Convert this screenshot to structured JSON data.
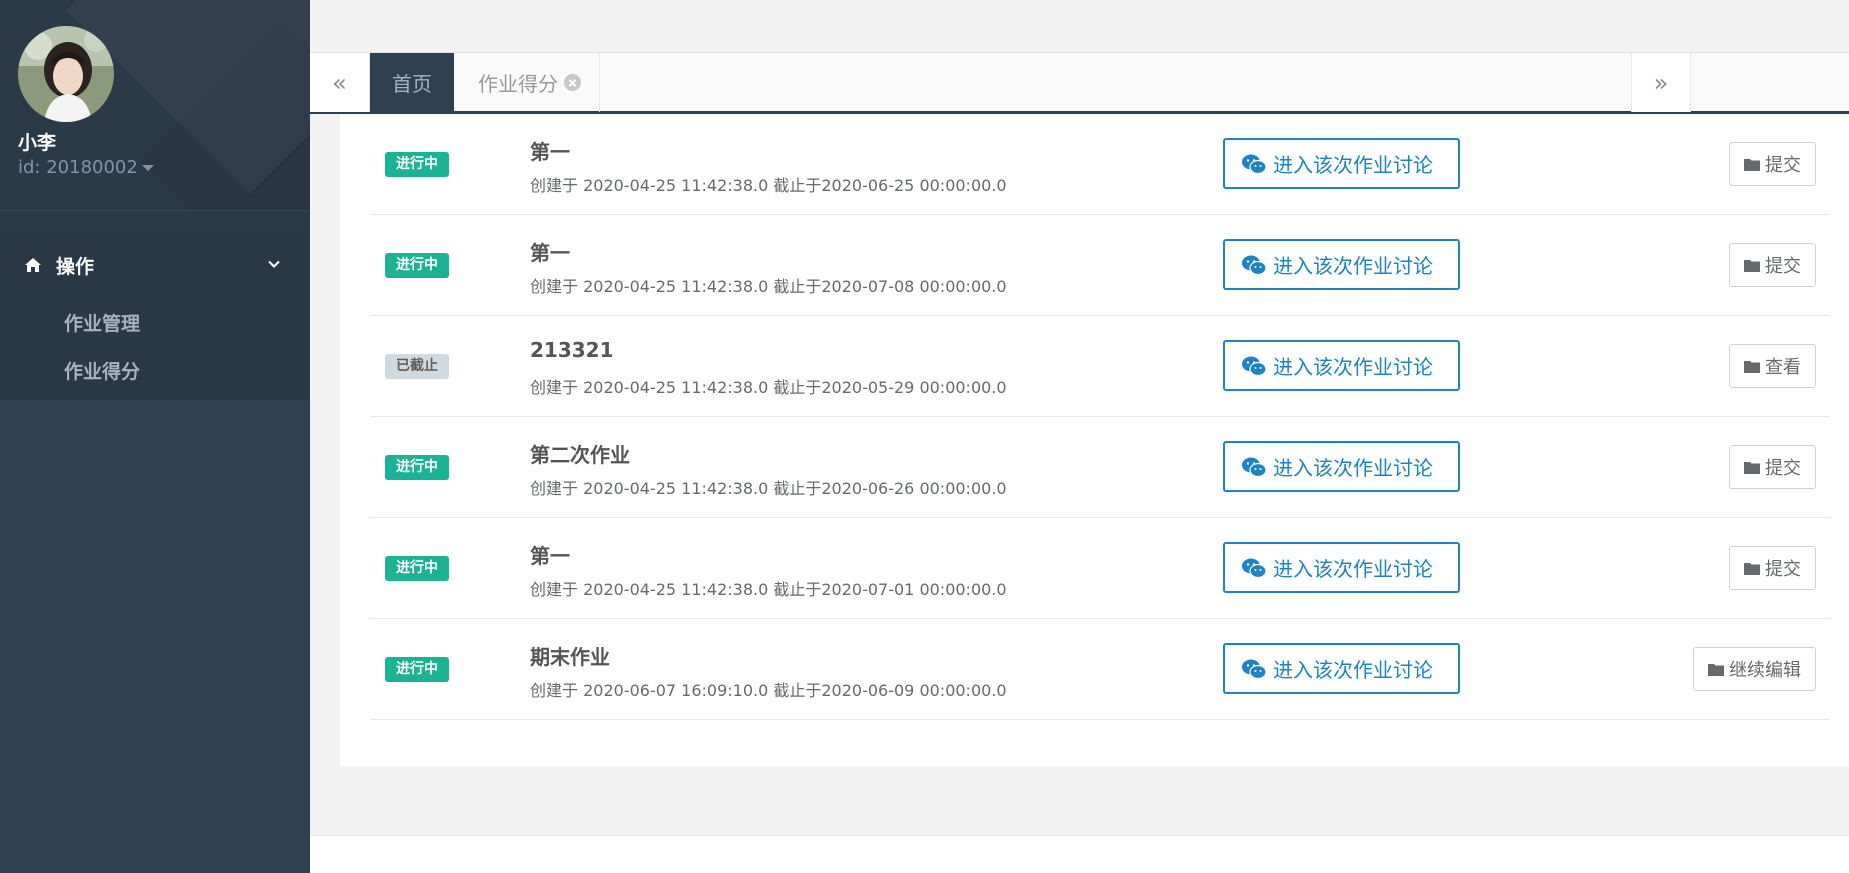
{
  "user": {
    "name": "小李",
    "id_label": "id: 20180002"
  },
  "nav": {
    "section_label": "操作",
    "items": [
      {
        "label": "作业管理"
      },
      {
        "label": "作业得分"
      }
    ]
  },
  "tabs": {
    "prev": "«",
    "next": "»",
    "items": [
      {
        "label": "首页",
        "active": true
      },
      {
        "label": "作业得分",
        "closable": true
      }
    ]
  },
  "assignments": [
    {
      "status": "进行中",
      "status_type": "active",
      "title": "第一",
      "meta": "创建于 2020-04-25 11:42:38.0 截止于2020-06-25 00:00:00.0",
      "discuss_label": "进入该次作业讨论",
      "action_label": "提交"
    },
    {
      "status": "进行中",
      "status_type": "active",
      "title": "第一",
      "meta": "创建于 2020-04-25 11:42:38.0 截止于2020-07-08 00:00:00.0",
      "discuss_label": "进入该次作业讨论",
      "action_label": "提交"
    },
    {
      "status": "已截止",
      "status_type": "closed",
      "title": "213321",
      "meta": "创建于 2020-04-25 11:42:38.0 截止于2020-05-29 00:00:00.0",
      "discuss_label": "进入该次作业讨论",
      "action_label": "查看"
    },
    {
      "status": "进行中",
      "status_type": "active",
      "title": "第二次作业",
      "meta": "创建于 2020-04-25 11:42:38.0 截止于2020-06-26 00:00:00.0",
      "discuss_label": "进入该次作业讨论",
      "action_label": "提交"
    },
    {
      "status": "进行中",
      "status_type": "active",
      "title": "第一",
      "meta": "创建于 2020-04-25 11:42:38.0 截止于2020-07-01 00:00:00.0",
      "discuss_label": "进入该次作业讨论",
      "action_label": "提交"
    },
    {
      "status": "进行中",
      "status_type": "active",
      "title": "期末作业",
      "meta": "创建于 2020-06-07 16:09:10.0 截止于2020-06-09 00:00:00.0",
      "discuss_label": "进入该次作业讨论",
      "action_label": "继续编辑"
    }
  ],
  "colors": {
    "sidebar": "#2f4050",
    "accent_green": "#1ab394",
    "accent_blue": "#1c84c6",
    "closed_badge": "#d1dade"
  },
  "icons": {
    "discuss": "wechat-icon",
    "action": "folder-icon",
    "nav": "home-icon",
    "nav_toggle": "chevron-down-icon",
    "tab_close": "close-circle-icon"
  }
}
